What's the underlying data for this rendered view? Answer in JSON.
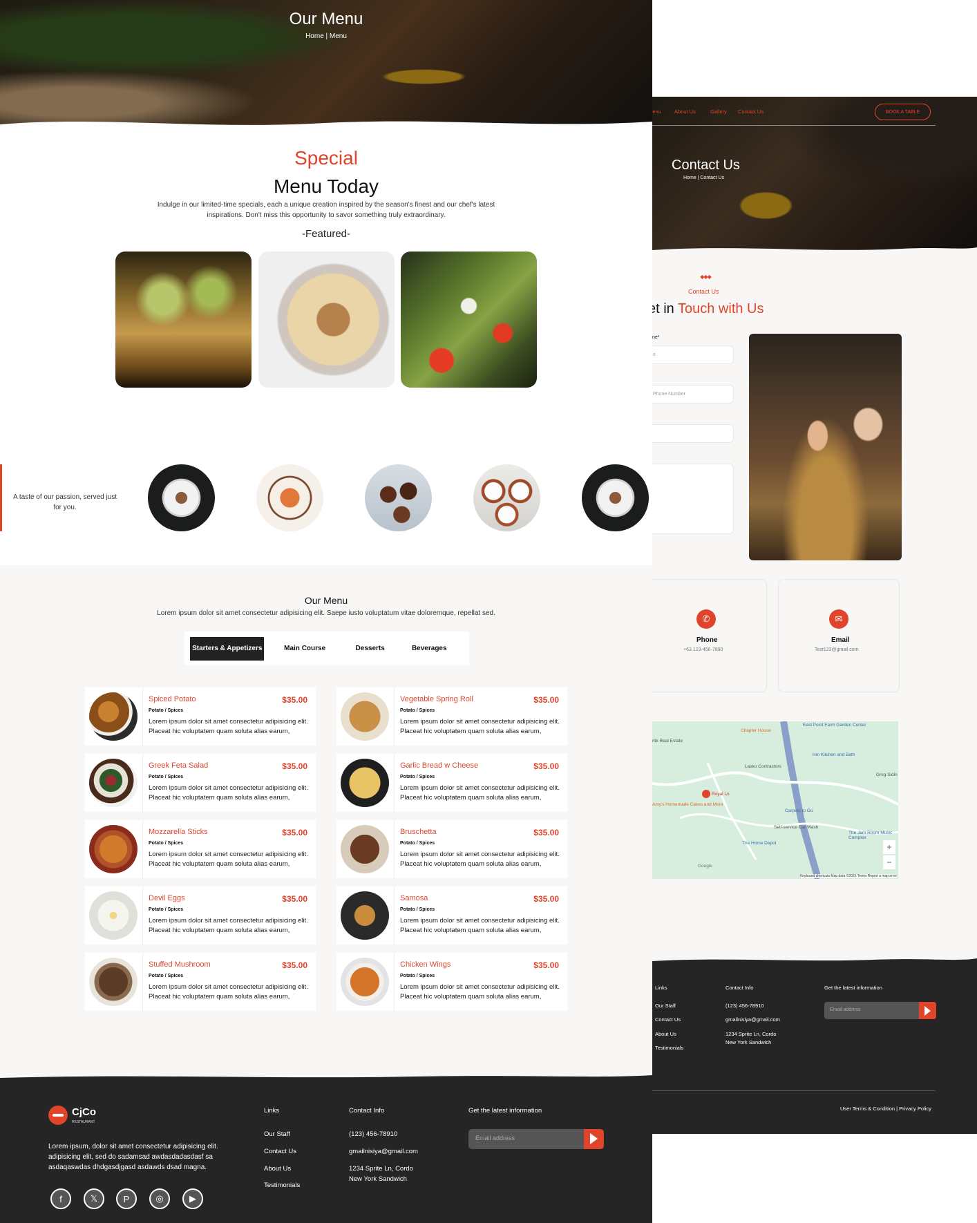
{
  "menu_page": {
    "hero": {
      "title": "Our Menu",
      "breadcrumb": "Home | Menu"
    },
    "special": {
      "title": "Special",
      "subtitle": "Menu Today",
      "description": "Indulge in our limited-time specials, each a unique creation inspired by the season's finest and our chef's latest inspirations. Don't miss this opportunity to savor something truly extraordinary.",
      "featured_label": "-Featured-",
      "featured_images": [
        "baklava",
        "chicken-pasta",
        "caprese-avocado"
      ]
    },
    "passion": {
      "text": "A taste of our passion, served just for you.",
      "dishes": [
        "steak-plate",
        "pasta-plate",
        "chocolate-mousse",
        "creme-brulee",
        "steak-plate"
      ]
    },
    "our_menu": {
      "title": "Our Menu",
      "description": "Lorem ipsum dolor sit amet consectetur adipisicing elit. Saepe iusto voluptatum vitae doloremque, repellat sed.",
      "tabs": [
        "Starters & Appetizers",
        "Main Course",
        "Desserts",
        "Beverages"
      ],
      "active_tab": "Starters & Appetizers",
      "items_left": [
        {
          "name": "Spiced Potato",
          "price": "$35.00",
          "sub": "Potato / Spices",
          "desc": "Lorem ipsum dolor sit amet consectetur adipisicing elit. Placeat hic voluptatem quam soluta alias earum,"
        },
        {
          "name": "Greek Feta Salad",
          "price": "$35.00",
          "sub": "Potato / Spices",
          "desc": "Lorem ipsum dolor sit amet consectetur adipisicing elit. Placeat hic voluptatem quam soluta alias earum,"
        },
        {
          "name": "Mozzarella Sticks",
          "price": "$35.00",
          "sub": "Potato / Spices",
          "desc": "Lorem ipsum dolor sit amet consectetur adipisicing elit. Placeat hic voluptatem quam soluta alias earum,"
        },
        {
          "name": "Devil Eggs",
          "price": "$35.00",
          "sub": "Potato / Spices",
          "desc": "Lorem ipsum dolor sit amet consectetur adipisicing elit. Placeat hic voluptatem quam soluta alias earum,"
        },
        {
          "name": "Stuffed Mushroom",
          "price": "$35.00",
          "sub": "Potato / Spices",
          "desc": "Lorem ipsum dolor sit amet consectetur adipisicing elit. Placeat hic voluptatem quam soluta alias earum,"
        }
      ],
      "items_right": [
        {
          "name": "Vegetable Spring Roll",
          "price": "$35.00",
          "sub": "Potato / Spices",
          "desc": "Lorem ipsum dolor sit amet consectetur adipisicing elit. Placeat hic voluptatem quam soluta alias earum,"
        },
        {
          "name": "Garlic Bread w Cheese",
          "price": "$35.00",
          "sub": "Potato / Spices",
          "desc": "Lorem ipsum dolor sit amet consectetur adipisicing elit. Placeat hic voluptatem quam soluta alias earum,"
        },
        {
          "name": "Bruschetta",
          "price": "$35.00",
          "sub": "Potato / Spices",
          "desc": "Lorem ipsum dolor sit amet consectetur adipisicing elit. Placeat hic voluptatem quam soluta alias earum,"
        },
        {
          "name": "Samosa",
          "price": "$35.00",
          "sub": "Potato / Spices",
          "desc": "Lorem ipsum dolor sit amet consectetur adipisicing elit. Placeat hic voluptatem quam soluta alias earum,"
        },
        {
          "name": "Chicken Wings",
          "price": "$35.00",
          "sub": "Potato / Spices",
          "desc": "Lorem ipsum dolor sit amet consectetur adipisicing elit. Placeat hic voluptatem quam soluta alias earum,"
        }
      ]
    },
    "footer": {
      "brand": "CjCo",
      "brand_tag": "RESTAURANT",
      "description": "Lorem ipsum, dolor sit amet consectetur adipisicing elit. adipisicing elit, sed do sadamsad awdasdadasdasf sa asdaqaswdas dhdgasdjgasd asdawds dsad magna.",
      "links_heading": "Links",
      "links": [
        "Our Staff",
        "Contact Us",
        "About Us",
        "Testimonials"
      ],
      "contact_heading": "Contact Info",
      "phone": "(123) 456-78910",
      "email": "gmailnisiya@gmail.com",
      "address_1": "1234 Sprite Ln, Cordo",
      "address_2": "New York Sandwich",
      "newsletter_heading": "Get the latest information",
      "email_placeholder": "Email address",
      "social_icons": [
        "facebook-icon",
        "x-icon",
        "pinterest-icon",
        "instagram-icon",
        "youtube-icon"
      ]
    }
  },
  "contact_page": {
    "nav": {
      "items": [
        "Menu",
        "About Us",
        "Gallery",
        "Contact Us"
      ],
      "book_button": "BOOK A TABLE"
    },
    "hero": {
      "title": "Contact Us",
      "breadcrumb": "Home | Contact Us"
    },
    "section": {
      "kicker": "Contact Us",
      "heading_start": "et in ",
      "heading_accent": "Touch with Us",
      "name_label": "ne*",
      "phone_placeholder": "Phone Number",
      "name_placeholder": "e"
    },
    "cards": [
      {
        "label": "Phone",
        "value": "+63 123-456-7890"
      },
      {
        "label": "Email",
        "value": "Test123@gmail.com"
      }
    ],
    "map": {
      "labels": [
        "Chapter House",
        "East Point Farm Garden Center",
        "rtik Real Estate",
        "Hm Kitchen and Bath",
        "Lasko Contractors",
        "Greg Sidin",
        "Royal Ln",
        "Amy's Homemade Cakes and More",
        "Carpets to Go",
        "Self-service Car Wash",
        "The Jam Room Music Complex",
        "The Home Depot",
        "Google"
      ],
      "attribution": "Keyboard shortcuts   Map data ©2025   Terms   Report a map error"
    },
    "footer": {
      "links_heading": "Links",
      "links": [
        "Our Staff",
        "Contact Us",
        "About Us",
        "Testimonials"
      ],
      "contact_heading": "Contact Info",
      "phone": "(123) 456-78910",
      "email": "gmailnisiya@gmail.com",
      "address_1": "1234 Sprite Ln, Cordo",
      "address_2": "New York Sandwich",
      "newsletter_heading": "Get the latest information",
      "email_placeholder": "Email address",
      "policy": "User Terms & Condition | Privacy Policy"
    }
  },
  "colors": {
    "accent": "#e0452b",
    "footer_bg": "#252525",
    "section_bg": "#f8f7f5"
  }
}
